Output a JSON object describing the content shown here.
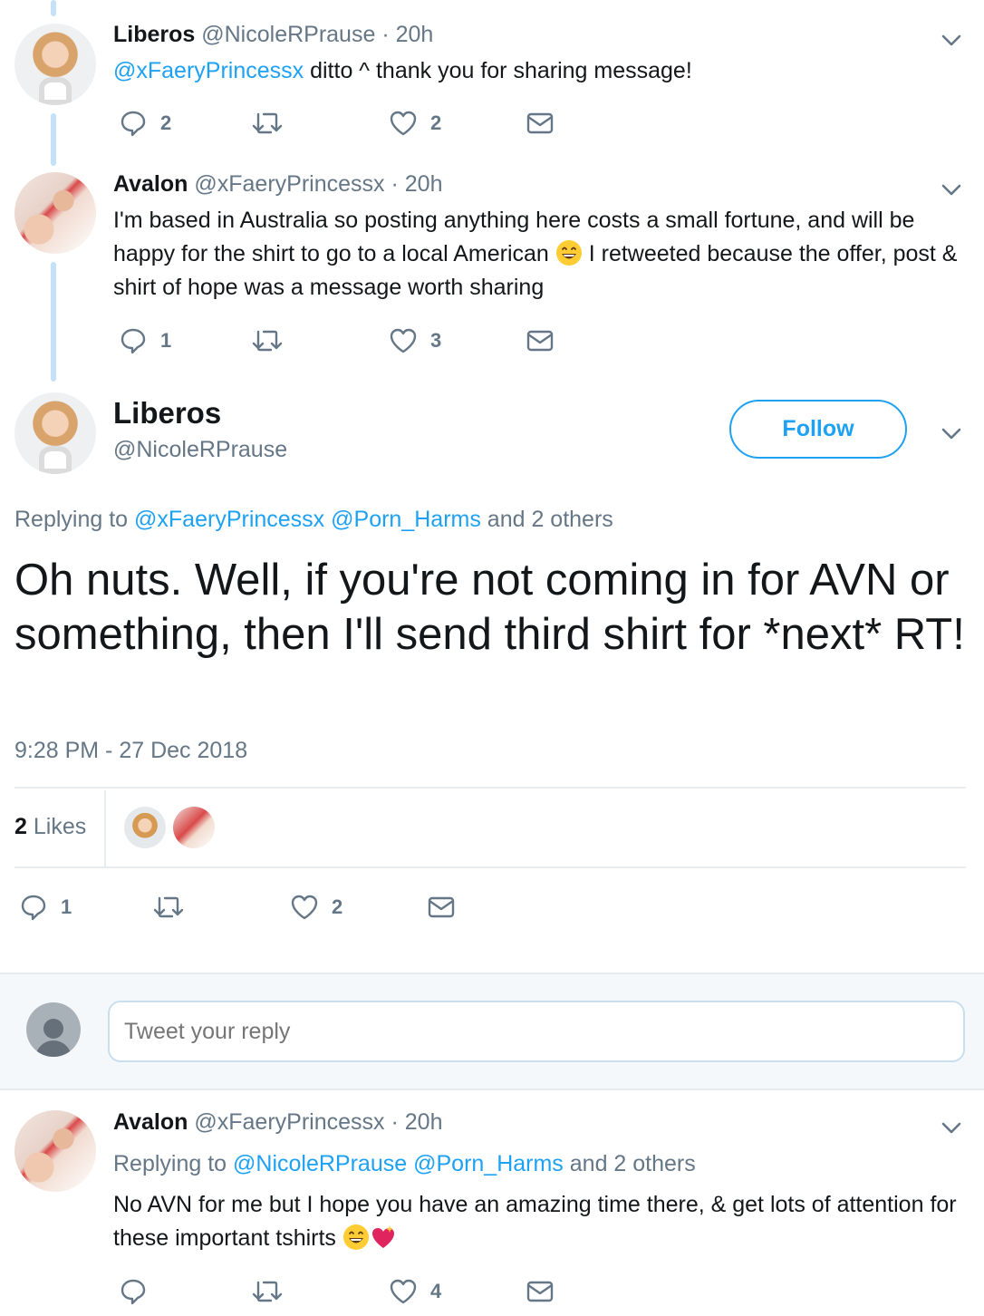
{
  "tweets": [
    {
      "name": "Liberos",
      "handle": "@NicoleRPrause",
      "sep": "·",
      "time": "20h",
      "mention": "@xFaeryPrincessx",
      "text": " ditto ^ thank you for sharing message!",
      "replies": "2",
      "retweets": "",
      "likes": "2"
    },
    {
      "name": "Avalon",
      "handle": "@xFaeryPrincessx",
      "sep": "·",
      "time": "20h",
      "text_a": "I'm based in Australia so posting anything here costs a small fortune, and will be happy for the shirt to go to a local American ",
      "text_b": " I retweeted because the offer, post & shirt of hope was a message worth sharing",
      "replies": "1",
      "retweets": "",
      "likes": "3"
    }
  ],
  "main_tweet": {
    "name": "Liberos",
    "handle": "@NicoleRPrause",
    "follow_label": "Follow",
    "replying_prefix": "Replying to ",
    "replying_to_1": "@xFaeryPrincessx",
    "replying_to_2": "@Porn_Harms",
    "replying_suffix": " and 2 others",
    "text": "Oh nuts. Well, if you're not coming in for AVN or something, then I'll send third shirt for *next* RT!",
    "timestamp": "9:28 PM - 27 Dec 2018",
    "likes_count": "2",
    "likes_label": "Likes",
    "replies": "1",
    "retweets": "",
    "likes": "2"
  },
  "reply_box": {
    "placeholder": "Tweet your reply"
  },
  "last_reply": {
    "name": "Avalon",
    "handle": "@xFaeryPrincessx",
    "sep": "·",
    "time": "20h",
    "replying_prefix": "Replying to ",
    "replying_to_1": "@NicoleRPrause",
    "replying_to_2": "@Porn_Harms",
    "replying_suffix": " and 2 others",
    "text_a": "No AVN for me  but I hope you have an amazing time there, & get lots of attention for these important tshirts ",
    "replies": "",
    "retweets": "",
    "likes": "4"
  },
  "colors": {
    "link": "#1da1f2",
    "muted": "#657786",
    "thread_line": "#c4e1f7"
  },
  "icons": [
    "reply-icon",
    "retweet-icon",
    "like-icon",
    "dm-icon",
    "chevron-down-icon",
    "grinning-emoji-icon",
    "sparkling-heart-icon"
  ]
}
